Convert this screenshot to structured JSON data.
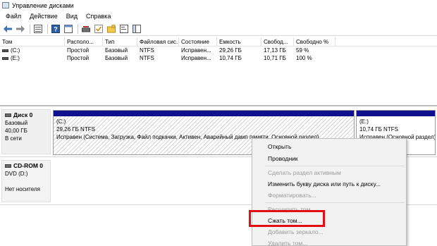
{
  "window": {
    "title": "Управление дисками"
  },
  "menu": [
    "Файл",
    "Действие",
    "Вид",
    "Справка"
  ],
  "toolbar": {
    "icons": [
      "back-arrow-icon",
      "forward-arrow-icon",
      "list-view-icon",
      "help-icon",
      "window-icon",
      "drive-icon",
      "check-icon",
      "new-folder-icon",
      "properties-icon",
      "panel-icon"
    ]
  },
  "volume_list": {
    "columns": [
      "Том",
      "Располо...",
      "Тип",
      "Файловая сис...",
      "Состояние",
      "Емкость",
      "Свобод...",
      "Свободно %"
    ],
    "rows": [
      [
        "(C:)",
        "Простой",
        "Базовый",
        "NTFS",
        "Исправен...",
        "29,26 ГБ",
        "17,13 ГБ",
        "59 %"
      ],
      [
        "(E:)",
        "Простой",
        "Базовый",
        "NTFS",
        "Исправен...",
        "10,74 ГБ",
        "10,71 ГБ",
        "100 %"
      ]
    ]
  },
  "disks": {
    "disk0": {
      "name": "Диск 0",
      "type": "Базовый",
      "size": "40,00 ГБ",
      "status": "В сети",
      "partitions": [
        {
          "name": "(C:)",
          "size": "29,26 ГБ NTFS",
          "status": "Исправен (Система, Загрузка, Файл подкачки, Активен, Аварийный дамп памяти, Основной раздел)"
        },
        {
          "name": "(E:)",
          "size": "10,74 ГБ NTFS",
          "status": "Исправен (Основной раздел)"
        }
      ]
    },
    "cdrom0": {
      "name": "CD-ROM 0",
      "type": "DVD (D:)",
      "status": "Нет носителя"
    }
  },
  "context_menu": {
    "items": [
      {
        "label": "Открыть",
        "enabled": true
      },
      {
        "label": "Проводник",
        "enabled": true
      },
      {
        "label": "Сделать раздел активным",
        "enabled": false
      },
      {
        "label": "Изменить букву диска или путь к диску...",
        "enabled": true
      },
      {
        "label": "Форматировать...",
        "enabled": false
      },
      {
        "label": "Расширить том...",
        "enabled": false
      },
      {
        "label": "Сжать том...",
        "enabled": true
      },
      {
        "label": "Добавить зеркало...",
        "enabled": false
      },
      {
        "label": "Удалить том...",
        "enabled": false
      }
    ],
    "highlighted_item": "Сжать том..."
  },
  "colors": {
    "partition_bar": "#10108f",
    "highlight": "#e30d12"
  }
}
